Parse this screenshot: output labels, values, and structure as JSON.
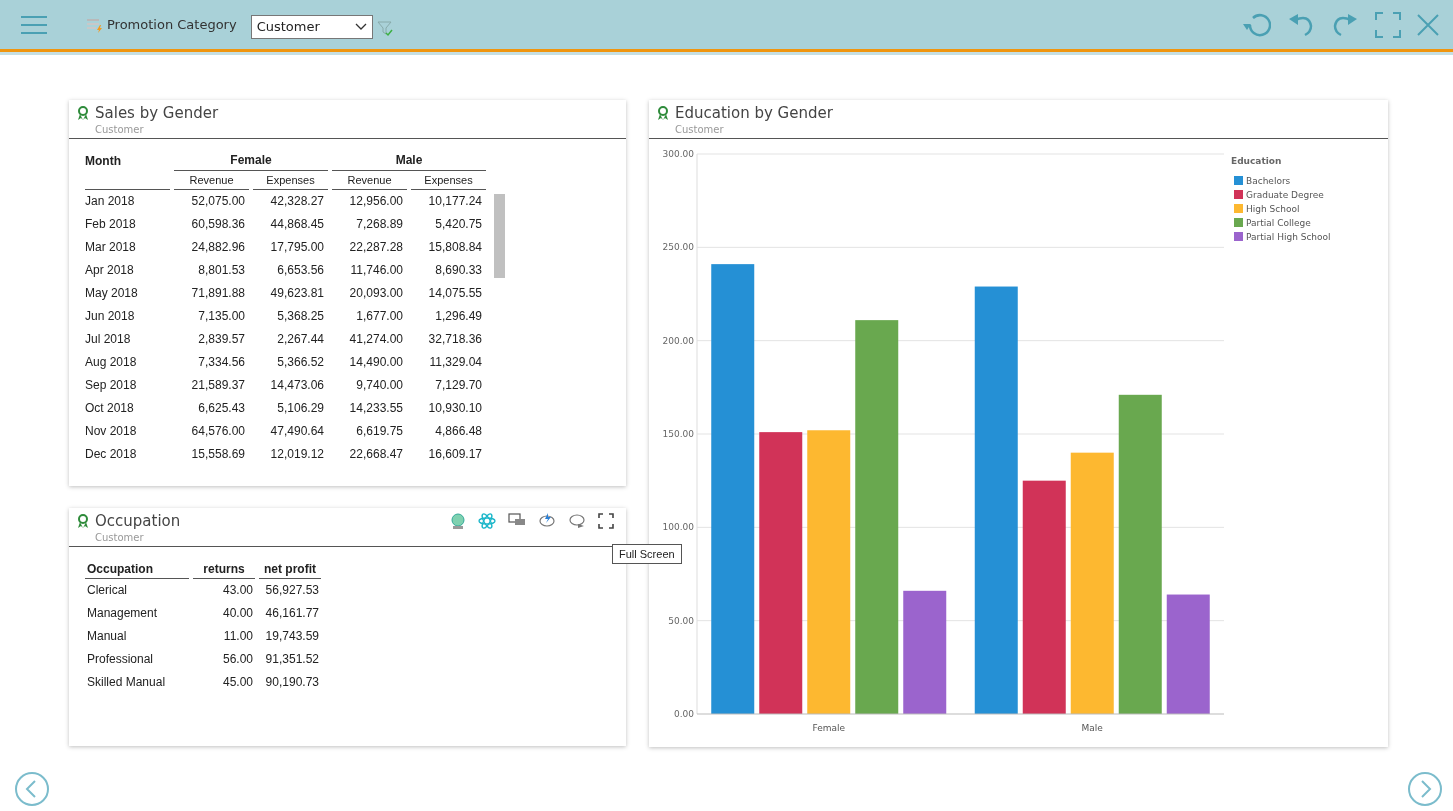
{
  "toolbar": {
    "filter_label": "Promotion Category",
    "filter_value": "Customer"
  },
  "sales_panel": {
    "title": "Sales by Gender",
    "subtitle": "Customer",
    "row_header": "Month",
    "groups": [
      "Female",
      "Male"
    ],
    "measures": [
      "Revenue",
      "Expenses",
      "Revenue",
      "Expenses"
    ],
    "rows": [
      [
        "Jan 2018",
        "52,075.00",
        "42,328.27",
        "12,956.00",
        "10,177.24"
      ],
      [
        "Feb 2018",
        "60,598.36",
        "44,868.45",
        "7,268.89",
        "5,420.75"
      ],
      [
        "Mar 2018",
        "24,882.96",
        "17,795.00",
        "22,287.28",
        "15,808.84"
      ],
      [
        "Apr 2018",
        "8,801.53",
        "6,653.56",
        "11,746.00",
        "8,690.33"
      ],
      [
        "May 2018",
        "71,891.88",
        "49,623.81",
        "20,093.00",
        "14,075.55"
      ],
      [
        "Jun 2018",
        "7,135.00",
        "5,368.25",
        "1,677.00",
        "1,296.49"
      ],
      [
        "Jul 2018",
        "2,839.57",
        "2,267.44",
        "41,274.00",
        "32,718.36"
      ],
      [
        "Aug 2018",
        "7,334.56",
        "5,366.52",
        "14,490.00",
        "11,329.04"
      ],
      [
        "Sep 2018",
        "21,589.37",
        "14,473.06",
        "9,740.00",
        "7,129.70"
      ],
      [
        "Oct 2018",
        "6,625.43",
        "5,106.29",
        "14,233.55",
        "10,930.10"
      ],
      [
        "Nov 2018",
        "64,576.00",
        "47,490.64",
        "6,619.75",
        "4,866.48"
      ],
      [
        "Dec 2018",
        "15,558.69",
        "12,019.12",
        "22,668.47",
        "16,609.17"
      ]
    ]
  },
  "occupation_panel": {
    "title": "Occupation",
    "subtitle": "Customer",
    "tooltip": "Full Screen",
    "columns": [
      "Occupation",
      "returns",
      "net profit"
    ],
    "rows": [
      [
        "Clerical",
        "43.00",
        "56,927.53"
      ],
      [
        "Management",
        "40.00",
        "46,161.77"
      ],
      [
        "Manual",
        "11.00",
        "19,743.59"
      ],
      [
        "Professional",
        "56.00",
        "91,351.52"
      ],
      [
        "Skilled Manual",
        "45.00",
        "90,190.73"
      ]
    ]
  },
  "education_panel": {
    "title": "Education by Gender",
    "subtitle": "Customer",
    "chart_data": {
      "type": "bar",
      "grid": true,
      "legend": {
        "title": "Education"
      },
      "categories": [
        "Female",
        "Male"
      ],
      "ylim": [
        0,
        300
      ],
      "yticks": [
        {
          "value": 0,
          "label": "0.00"
        },
        {
          "value": 50,
          "label": "50.00"
        },
        {
          "value": 100,
          "label": "100.00"
        },
        {
          "value": 150,
          "label": "150.00"
        },
        {
          "value": 200,
          "label": "200.00"
        },
        {
          "value": 250,
          "label": "250.00"
        },
        {
          "value": 300,
          "label": "300.00"
        }
      ],
      "series": [
        {
          "name": "Bachelors",
          "color": "#2590d5",
          "values": [
            241,
            229
          ]
        },
        {
          "name": "Graduate Degree",
          "color": "#d13358",
          "values": [
            151,
            125
          ]
        },
        {
          "name": "High School",
          "color": "#fdb830",
          "values": [
            152,
            140
          ]
        },
        {
          "name": "Partial College",
          "color": "#69a84f",
          "values": [
            211,
            171
          ]
        },
        {
          "name": "Partial High School",
          "color": "#9b64cd",
          "values": [
            66,
            64
          ]
        }
      ]
    }
  }
}
